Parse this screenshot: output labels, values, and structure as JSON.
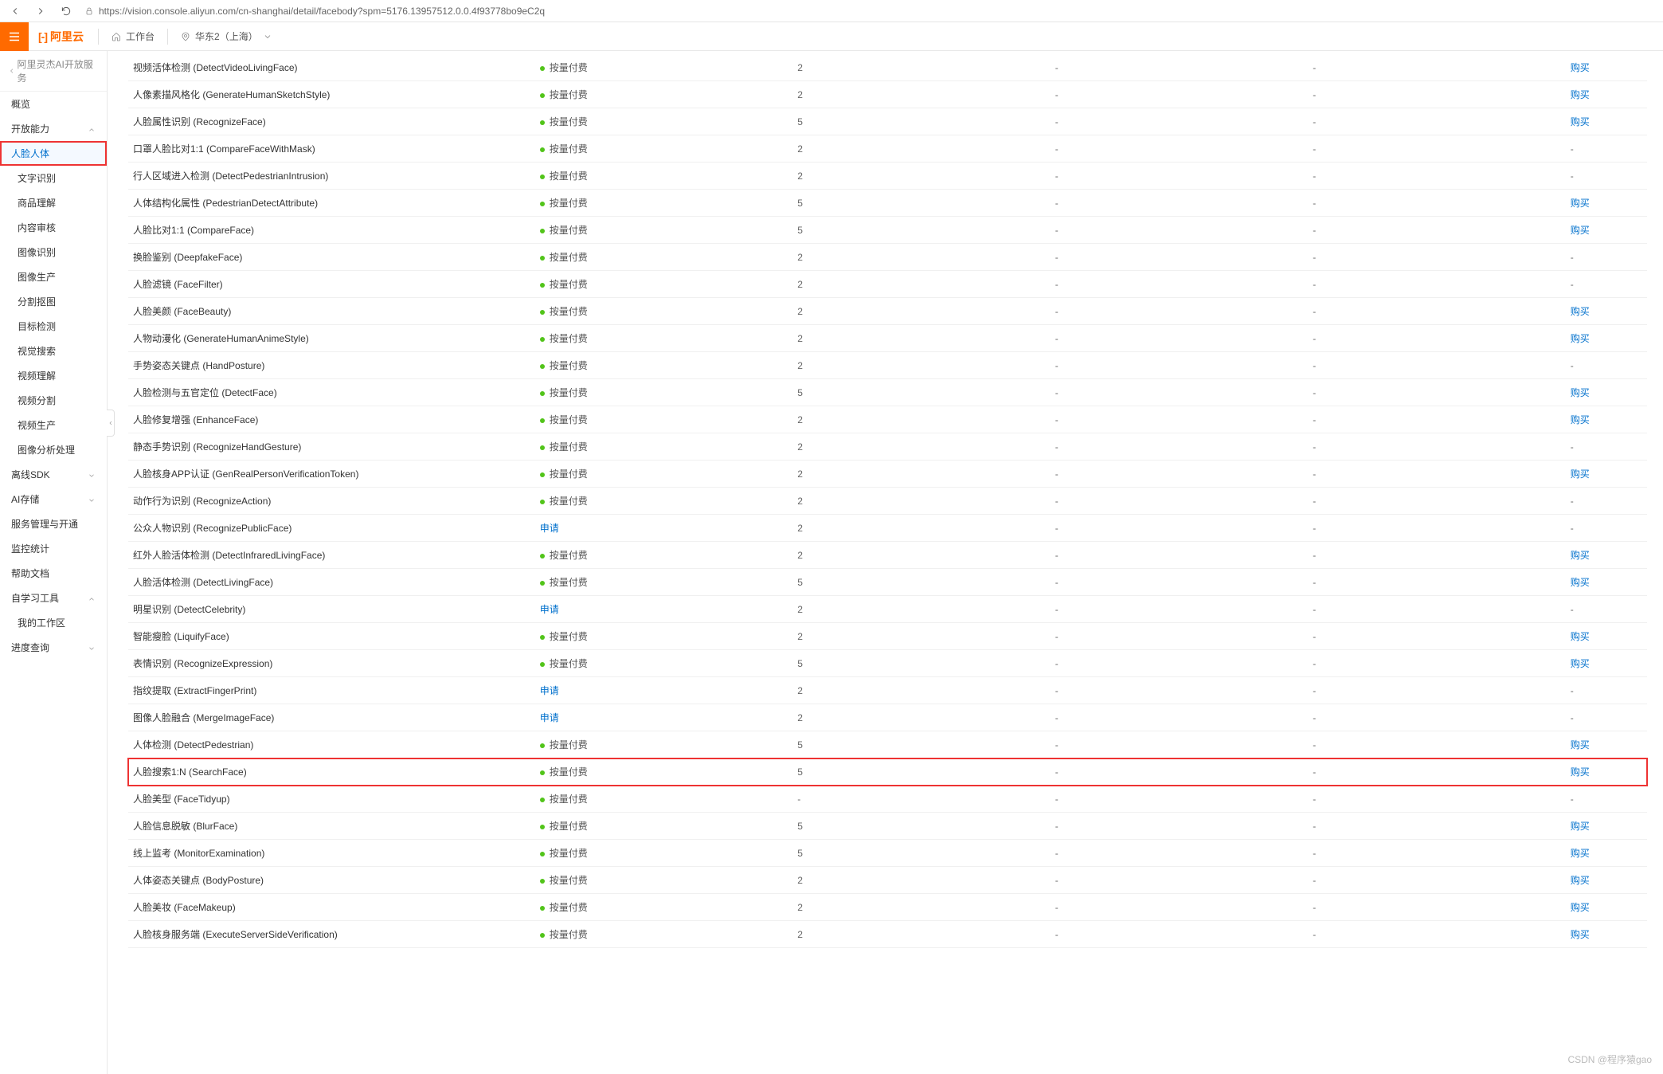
{
  "url": "https://vision.console.aliyun.com/cn-shanghai/detail/facebody?spm=5176.13957512.0.0.4f93778bo9eC2q",
  "brand": "阿里云",
  "top": {
    "workspace": "工作台",
    "region": "华东2（上海）"
  },
  "back_label": "阿里灵杰AI开放服务",
  "nav": {
    "overview": "概览",
    "capability": "开放能力",
    "capability_children": [
      "人脸人体",
      "文字识别",
      "商品理解",
      "内容审核",
      "图像识别",
      "图像生产",
      "分割抠图",
      "目标检测",
      "视觉搜索",
      "视频理解",
      "视频分割",
      "视频生产",
      "图像分析处理"
    ],
    "sdk": "离线SDK",
    "storage": "AI存储",
    "service": "服务管理与开通",
    "monitor": "监控统计",
    "docs": "帮助文档",
    "selfstudy": "自学习工具",
    "selfstudy_children": [
      "我的工作区"
    ],
    "progress": "进度查询"
  },
  "status_labels": {
    "pay": "按量付费",
    "apply": "申请"
  },
  "action_label": "购买",
  "rows": [
    {
      "name": "视频活体检测 (DetectVideoLivingFace)",
      "status": "pay",
      "qps": "2",
      "c4": "-",
      "c5": "-",
      "action": "buy"
    },
    {
      "name": "人像素描风格化 (GenerateHumanSketchStyle)",
      "status": "pay",
      "qps": "2",
      "c4": "-",
      "c5": "-",
      "action": "buy"
    },
    {
      "name": "人脸属性识别 (RecognizeFace)",
      "status": "pay",
      "qps": "5",
      "c4": "-",
      "c5": "-",
      "action": "buy"
    },
    {
      "name": "口罩人脸比对1:1 (CompareFaceWithMask)",
      "status": "pay",
      "qps": "2",
      "c4": "-",
      "c5": "-",
      "action": "none"
    },
    {
      "name": "行人区域进入检测 (DetectPedestrianIntrusion)",
      "status": "pay",
      "qps": "2",
      "c4": "-",
      "c5": "-",
      "action": "none"
    },
    {
      "name": "人体结构化属性 (PedestrianDetectAttribute)",
      "status": "pay",
      "qps": "5",
      "c4": "-",
      "c5": "-",
      "action": "buy"
    },
    {
      "name": "人脸比对1:1 (CompareFace)",
      "status": "pay",
      "qps": "5",
      "c4": "-",
      "c5": "-",
      "action": "buy"
    },
    {
      "name": "换脸鉴别 (DeepfakeFace)",
      "status": "pay",
      "qps": "2",
      "c4": "-",
      "c5": "-",
      "action": "none"
    },
    {
      "name": "人脸滤镜 (FaceFilter)",
      "status": "pay",
      "qps": "2",
      "c4": "-",
      "c5": "-",
      "action": "none"
    },
    {
      "name": "人脸美颜 (FaceBeauty)",
      "status": "pay",
      "qps": "2",
      "c4": "-",
      "c5": "-",
      "action": "buy"
    },
    {
      "name": "人物动漫化 (GenerateHumanAnimeStyle)",
      "status": "pay",
      "qps": "2",
      "c4": "-",
      "c5": "-",
      "action": "buy"
    },
    {
      "name": "手势姿态关键点 (HandPosture)",
      "status": "pay",
      "qps": "2",
      "c4": "-",
      "c5": "-",
      "action": "none"
    },
    {
      "name": "人脸检测与五官定位 (DetectFace)",
      "status": "pay",
      "qps": "5",
      "c4": "-",
      "c5": "-",
      "action": "buy"
    },
    {
      "name": "人脸修复增强 (EnhanceFace)",
      "status": "pay",
      "qps": "2",
      "c4": "-",
      "c5": "-",
      "action": "buy"
    },
    {
      "name": "静态手势识别 (RecognizeHandGesture)",
      "status": "pay",
      "qps": "2",
      "c4": "-",
      "c5": "-",
      "action": "none"
    },
    {
      "name": "人脸核身APP认证 (GenRealPersonVerificationToken)",
      "status": "pay",
      "qps": "2",
      "c4": "-",
      "c5": "-",
      "action": "buy"
    },
    {
      "name": "动作行为识别 (RecognizeAction)",
      "status": "pay",
      "qps": "2",
      "c4": "-",
      "c5": "-",
      "action": "none"
    },
    {
      "name": "公众人物识别 (RecognizePublicFace)",
      "status": "apply",
      "qps": "2",
      "c4": "-",
      "c5": "-",
      "action": "none"
    },
    {
      "name": "红外人脸活体检测 (DetectInfraredLivingFace)",
      "status": "pay",
      "qps": "2",
      "c4": "-",
      "c5": "-",
      "action": "buy"
    },
    {
      "name": "人脸活体检测 (DetectLivingFace)",
      "status": "pay",
      "qps": "5",
      "c4": "-",
      "c5": "-",
      "action": "buy"
    },
    {
      "name": "明星识别 (DetectCelebrity)",
      "status": "apply",
      "qps": "2",
      "c4": "-",
      "c5": "-",
      "action": "none"
    },
    {
      "name": "智能瘦脸 (LiquifyFace)",
      "status": "pay",
      "qps": "2",
      "c4": "-",
      "c5": "-",
      "action": "buy"
    },
    {
      "name": "表情识别 (RecognizeExpression)",
      "status": "pay",
      "qps": "5",
      "c4": "-",
      "c5": "-",
      "action": "buy"
    },
    {
      "name": "指纹提取 (ExtractFingerPrint)",
      "status": "apply",
      "qps": "2",
      "c4": "-",
      "c5": "-",
      "action": "none"
    },
    {
      "name": "图像人脸融合 (MergeImageFace)",
      "status": "apply",
      "qps": "2",
      "c4": "-",
      "c5": "-",
      "action": "none"
    },
    {
      "name": "人体检测 (DetectPedestrian)",
      "status": "pay",
      "qps": "5",
      "c4": "-",
      "c5": "-",
      "action": "buy"
    },
    {
      "name": "人脸搜索1:N (SearchFace)",
      "status": "pay",
      "qps": "5",
      "c4": "-",
      "c5": "-",
      "action": "buy",
      "highlight": true
    },
    {
      "name": "人脸美型 (FaceTidyup)",
      "status": "pay",
      "qps": "-",
      "c4": "-",
      "c5": "-",
      "action": "none"
    },
    {
      "name": "人脸信息脱敏 (BlurFace)",
      "status": "pay",
      "qps": "5",
      "c4": "-",
      "c5": "-",
      "action": "buy"
    },
    {
      "name": "线上监考 (MonitorExamination)",
      "status": "pay",
      "qps": "5",
      "c4": "-",
      "c5": "-",
      "action": "buy"
    },
    {
      "name": "人体姿态关键点 (BodyPosture)",
      "status": "pay",
      "qps": "2",
      "c4": "-",
      "c5": "-",
      "action": "buy"
    },
    {
      "name": "人脸美妆 (FaceMakeup)",
      "status": "pay",
      "qps": "2",
      "c4": "-",
      "c5": "-",
      "action": "buy"
    },
    {
      "name": "人脸核身服务端 (ExecuteServerSideVerification)",
      "status": "pay",
      "qps": "2",
      "c4": "-",
      "c5": "-",
      "action": "buy"
    }
  ],
  "watermark": "CSDN @程序猿gao"
}
